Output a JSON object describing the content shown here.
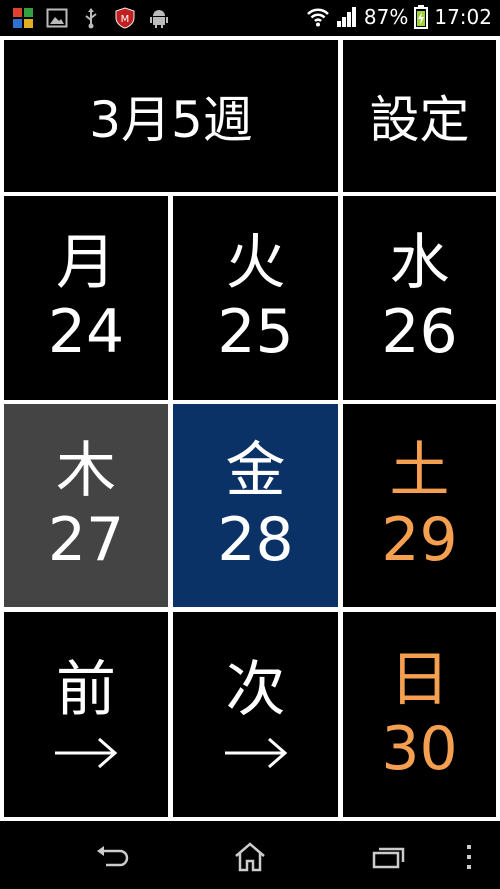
{
  "status_bar": {
    "battery_percent": "87%",
    "time": "17:02",
    "icons": [
      "app-grid-icon",
      "image-icon",
      "usb-icon",
      "shield-icon",
      "android-icon"
    ]
  },
  "header": {
    "week_label": "3月5週",
    "settings_label": "設定"
  },
  "days": [
    {
      "weekday": "月",
      "date": "24"
    },
    {
      "weekday": "火",
      "date": "25"
    },
    {
      "weekday": "水",
      "date": "26"
    },
    {
      "weekday": "木",
      "date": "27"
    },
    {
      "weekday": "金",
      "date": "28"
    },
    {
      "weekday": "土",
      "date": "29"
    },
    {
      "weekday": "日",
      "date": "30"
    }
  ],
  "nav": {
    "prev_label": "前",
    "next_label": "次"
  },
  "colors": {
    "weekend": "#f5a050",
    "selected_past": "#444444",
    "today": "#0b3266"
  }
}
